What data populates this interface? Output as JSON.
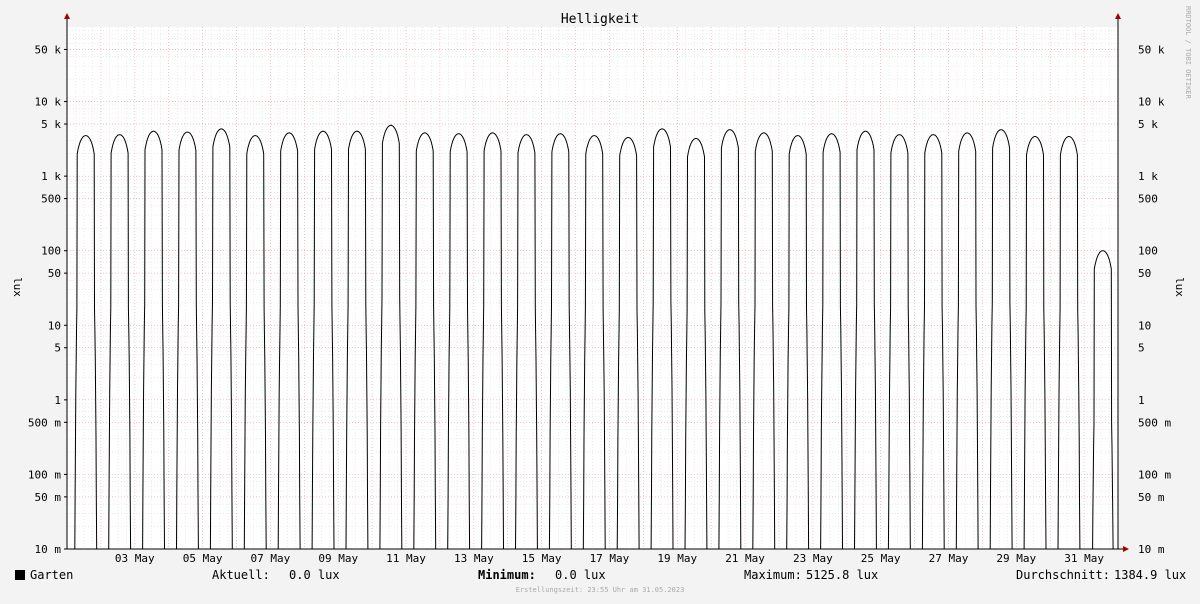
{
  "chart_data": {
    "type": "line",
    "title": "Helligkeit",
    "ylabel": "lux",
    "yscale": "log",
    "ylim": [
      0.01,
      100000
    ],
    "ytick_values": [
      0.01,
      0.05,
      0.1,
      0.5,
      1,
      5,
      10,
      50,
      100,
      500,
      1000,
      5000,
      10000,
      50000
    ],
    "ytick_labels": [
      "10 m",
      "50 m",
      "100 m",
      "500 m",
      "1",
      "5",
      "10",
      "50",
      "100",
      "500",
      "1 k",
      "5 k",
      "10 k",
      "50 k"
    ],
    "x_tick_labels": [
      "03 May",
      "05 May",
      "07 May",
      "09 May",
      "11 May",
      "13 May",
      "15 May",
      "17 May",
      "19 May",
      "21 May",
      "23 May",
      "25 May",
      "27 May",
      "29 May",
      "31 May"
    ],
    "x_start": "2023-05-01",
    "x_end": "2023-06-01",
    "series": [
      {
        "name": "Garten",
        "color": "#000000",
        "daily_peak_lux": [
          3500,
          3600,
          4000,
          3900,
          4300,
          3500,
          3800,
          4000,
          4000,
          4800,
          3800,
          3700,
          3800,
          3600,
          3700,
          3500,
          3300,
          4300,
          3200,
          4200,
          3800,
          3500,
          3700,
          4000,
          3600,
          3600,
          3800,
          4200,
          3400,
          3400,
          100
        ]
      }
    ]
  },
  "legend": {
    "series_name": "Garten",
    "current_label": "Aktuell:",
    "current_value": "0.0 lux",
    "minimum_label": "Minimum:",
    "minimum_value": "0.0 lux",
    "maximum_label": "Maximum:",
    "maximum_value": "5125.8 lux",
    "average_label": "Durchschnitt:",
    "average_value": "1384.9 lux"
  },
  "footer": "Erstellungszeit: 23:55 Uhr am 31.05.2023",
  "credit": "RRDTOOL / TOBI OETIKER"
}
